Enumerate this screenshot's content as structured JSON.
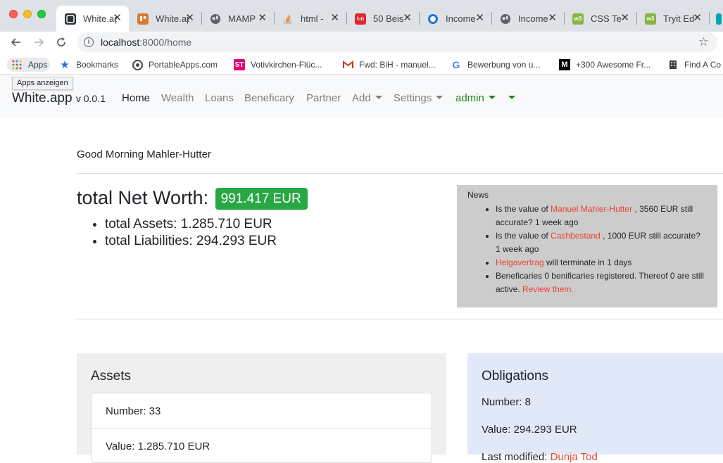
{
  "browser": {
    "tabs": [
      {
        "title": "White.app",
        "favicon_color": "#2b3137",
        "active": true
      },
      {
        "title": "White.app",
        "favicon_color": "#d97b33"
      },
      {
        "title": "MAMP",
        "favicon_color": "#5f6368"
      },
      {
        "title": "html - ",
        "favicon_color": "#f48024"
      },
      {
        "title": "50 Beis",
        "favicon_color": "#e0262f"
      },
      {
        "title": "Income",
        "favicon_color": "#1a73e8"
      },
      {
        "title": "Income",
        "favicon_color": "#5f6368"
      },
      {
        "title": "CSS Te",
        "favicon_color": "#88b443"
      },
      {
        "title": "Tryit Ed",
        "favicon_color": "#88b443"
      },
      {
        "title": "",
        "favicon_color": "#00a3b4"
      }
    ],
    "url": {
      "host": "localhost",
      "path": ":8000/home"
    },
    "bookmarks": [
      {
        "label": "Apps",
        "icon": "apps-grid-icon"
      },
      {
        "label": "Bookmarks",
        "icon": "star-icon"
      },
      {
        "label": "PortableApps.com",
        "icon": "portableapps-icon"
      },
      {
        "label": "Votivkirchen-Flüc...",
        "icon": "telekom-icon"
      },
      {
        "label": "Fwd: BiH - manuel...",
        "icon": "gmail-icon"
      },
      {
        "label": "Bewerbung von u...",
        "icon": "google-icon"
      },
      {
        "label": "+300 Awesome Fr...",
        "icon": "medium-icon"
      },
      {
        "label": "Find A Co",
        "icon": "building-icon"
      }
    ],
    "tooltip": "Apps anzeigen"
  },
  "app": {
    "brand": "White.app",
    "version": "v 0.0.1",
    "nav": {
      "home": "Home",
      "wealth": "Wealth",
      "loans": "Loans",
      "beneficary": "Beneficary",
      "partner": "Partner",
      "add": "Add",
      "settings": "Settings",
      "admin": "admin"
    }
  },
  "main": {
    "greeting": "Good Morning Mahler-Hutter",
    "net_worth_label": "total Net Worth:",
    "net_worth_value": "991.417 EUR",
    "total_assets": "total Assets: 1.285.710 EUR",
    "total_liabilities": "total Liabilities: 294.293 EUR"
  },
  "news": {
    "title": "News",
    "items": [
      {
        "prefix": "Is the value of ",
        "link": "Manuel Mahler-Hutter",
        "suffix": " , 3560 EUR still accurate? 1 week ago"
      },
      {
        "prefix": "Is the value of ",
        "link": "Cashbestand",
        "suffix": " , 1000 EUR still accurate? 1 week ago"
      },
      {
        "prefix": "",
        "link": "Helgavertrag",
        "suffix": " will terminate in 1 days"
      },
      {
        "prefix": "Beneficaries 0 benificaries registered. Thereof 0 are still active. ",
        "link": "Review them.",
        "suffix": ""
      }
    ]
  },
  "assets_card": {
    "title": "Assets",
    "number": "Number: 33",
    "value": "Value: 1.285.710 EUR"
  },
  "obligations_card": {
    "title": "Obligations",
    "number": "Number: 8",
    "value": "Value: 294.293 EUR",
    "last_modified_prefix": "Last modified: ",
    "last_modified_link": "Dunja Tod"
  },
  "colors": {
    "accent_green": "#28a745",
    "link_red": "#e8442f",
    "admin_green": "#208327",
    "news_bg": "#cccccc",
    "assets_bg": "#efefef",
    "obligations_bg": "#e1e9f8"
  }
}
